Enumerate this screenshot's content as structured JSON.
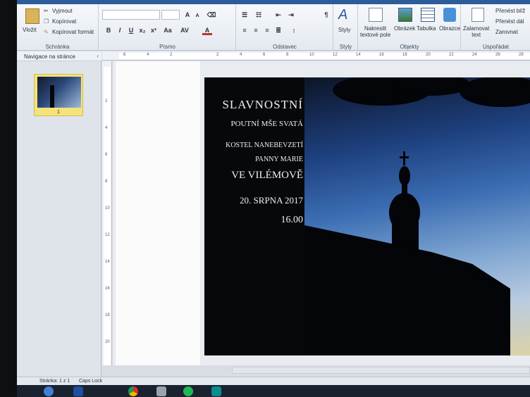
{
  "ribbon": {
    "clipboard": {
      "paste_label": "Vložit",
      "cut_label": "Vyjmout",
      "copy_label": "Kopírovat",
      "format_painter_label": "Kopírovat formát",
      "group_label": "Schránka"
    },
    "font": {
      "group_label": "Písmo"
    },
    "paragraph": {
      "group_label": "Odstavec"
    },
    "styles": {
      "button_label": "Styly",
      "group_label": "Styly"
    },
    "objects": {
      "draw_textbox_label": "Nakreslit\ntextové pole",
      "picture_label": "Obrázek",
      "table_label": "Tabulka",
      "shapes_label": "Obrazce",
      "group_label": "Objekty"
    },
    "arrange": {
      "wrap_text_label": "Zalamovat\ntext",
      "bring_forward_label": "Přenést blíž",
      "send_backward_label": "Přenést dál",
      "align_label": "Zarovnat",
      "group_label": "Uspořádat"
    }
  },
  "nav_pane": {
    "title": "Navigace na stránce",
    "page_number": "1"
  },
  "rulers": {
    "horizontal_ticks": [
      "6",
      "4",
      "2",
      "",
      "2",
      "4",
      "6",
      "8",
      "10",
      "12",
      "14",
      "16",
      "18",
      "20",
      "22",
      "24",
      "26",
      "28"
    ],
    "vertical_ticks": [
      "",
      "2",
      "4",
      "6",
      "8",
      "10",
      "12",
      "14",
      "16",
      "18",
      "20"
    ]
  },
  "document": {
    "line1": "SLAVNOSTNÍ",
    "line2": "POUTNÍ MŠE SVATÁ",
    "line3": "KOSTEL NANEBEVZETÍ",
    "line4": "PANNY MARIE",
    "line5": "VE VILÉMOVĚ",
    "line6": "20. SRPNA 2017",
    "line7": "16.00"
  },
  "status_bar": {
    "page_info": "Stránka: 1 z 1",
    "caps_lock": "Caps Lock"
  },
  "colors": {
    "ribbon_bg": "#e4e9f0",
    "accent": "#2c5c9a",
    "thumbnail_highlight": "#f4e27a"
  }
}
